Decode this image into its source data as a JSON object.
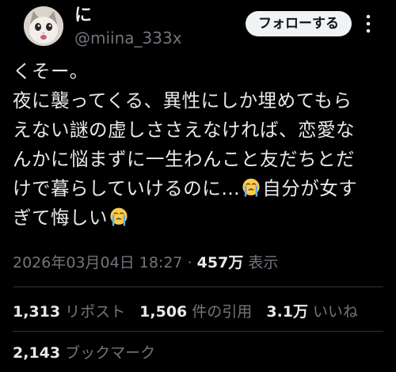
{
  "author": {
    "display_name": "に",
    "handle": "@miina_333x"
  },
  "follow_label": "フォローする",
  "post": {
    "lines": [
      "くそー。",
      "夜に襲ってくる、異性にしか埋めてもら",
      "えない謎の虚しささえなければ、恋愛な",
      "んかに悩まずに一生わんこと友だちとだ",
      "けで暮らしていけるのに…",
      "自分が女す",
      "ぎて悔しい"
    ]
  },
  "meta": {
    "timestamp": "2026年03月04日 18:27",
    "separator": "·",
    "views_count": "457万",
    "views_label": "表示"
  },
  "stats": {
    "reposts_count": "1,313",
    "reposts_label": "リポスト",
    "quotes_count": "1,506",
    "quotes_label": "件の引用",
    "likes_count": "3.1万",
    "likes_label": "いいね",
    "bookmarks_count": "2,143",
    "bookmarks_label": "ブックマーク"
  },
  "colors": {
    "background": "#000000",
    "text": "#e7e9ea",
    "muted": "#71767b",
    "divider": "#2f3336",
    "button_bg": "#eff3f4"
  },
  "icons": {
    "emoji": "loudly-crying-face-emoji",
    "more": "more-options-icon"
  }
}
